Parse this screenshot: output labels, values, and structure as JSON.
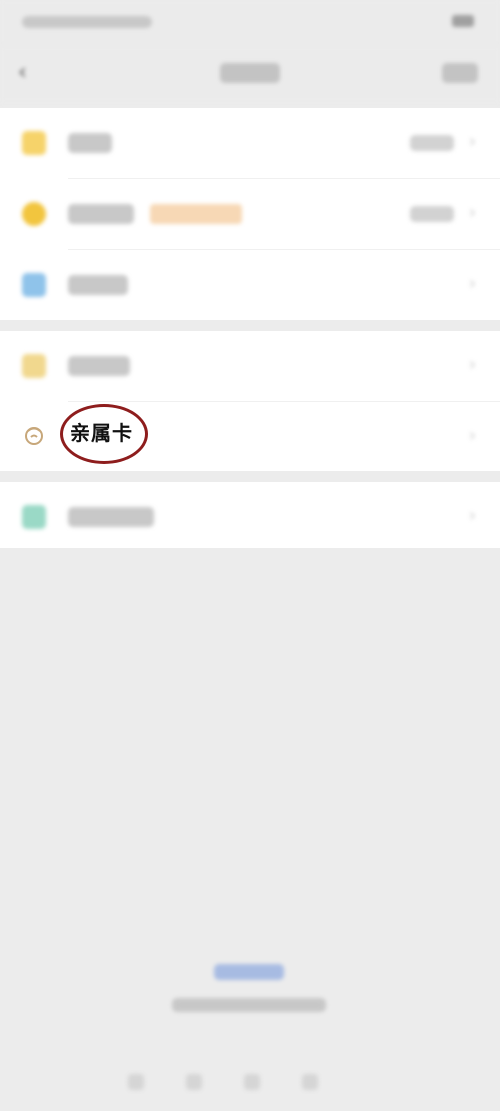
{
  "selected_item": {
    "label": "亲属卡"
  },
  "icons": {
    "back": "chevron-left-icon",
    "change": "wallet-icon",
    "licai": "coin-icon",
    "bank_card": "bank-card-icon",
    "pay_points": "points-icon",
    "family_card": "family-card-icon",
    "security": "shield-icon",
    "row_arrow": "chevron-right-icon"
  },
  "colors": {
    "highlight_ring": "#8e1d1d",
    "badge": "#f4c795",
    "link": "#8ba7df"
  }
}
